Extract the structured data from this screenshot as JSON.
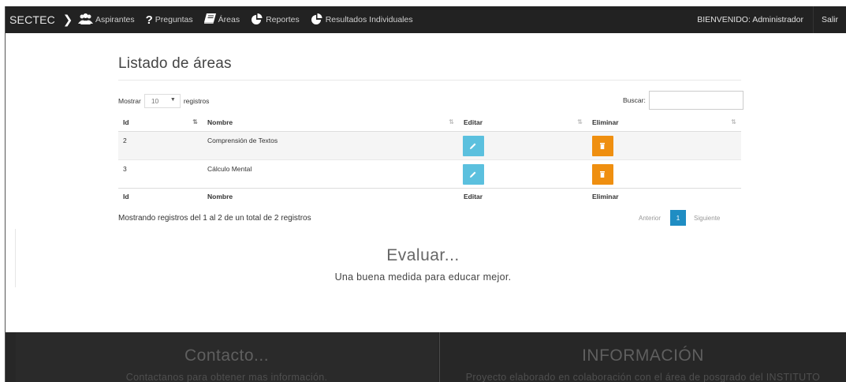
{
  "navbar": {
    "brand": "SECTEC",
    "items": [
      {
        "label": "Aspirantes",
        "icon": "users-icon"
      },
      {
        "label": "Preguntas",
        "icon": "question-icon"
      },
      {
        "label": "Áreas",
        "icon": "book-icon"
      },
      {
        "label": "Reportes",
        "icon": "pie-chart-icon"
      },
      {
        "label": "Resultados Individuales",
        "icon": "pie-chart-icon"
      }
    ],
    "welcome": "BIENVENIDO: Administrador",
    "logout": "Salir"
  },
  "main": {
    "title": "Listado de áreas",
    "length": {
      "prefix": "Mostrar",
      "value": "10",
      "suffix": "registros"
    },
    "search_label": "Buscar:",
    "search_value": "",
    "columns": [
      "Id",
      "Nombre",
      "Editar",
      "Eliminar"
    ],
    "rows": [
      {
        "id": "2",
        "name": "Comprensión de Textos"
      },
      {
        "id": "3",
        "name": "Cálculo Mental"
      }
    ],
    "info": "Mostrando registros del 1 al 2 de un total de 2 registros",
    "pagination": {
      "prev": "Anterior",
      "current": "1",
      "next": "Siguiente"
    }
  },
  "eval": {
    "title": "Evaluar...",
    "subtitle": "Una buena medida para educar mejor."
  },
  "footer": {
    "left_heading": "Contacto...",
    "left_text": "Contactanos para obtener mas información.",
    "right_heading": "INFORMACIÓN",
    "right_text": "Proyecto elaborado en colaboración con el área de posgrado del INSTITUTO"
  },
  "colors": {
    "navbar": "#222222",
    "edit_button": "#5bc0de",
    "delete_button": "#ef8f10",
    "pager_active": "#1f8dc3",
    "footer": "#272727"
  }
}
